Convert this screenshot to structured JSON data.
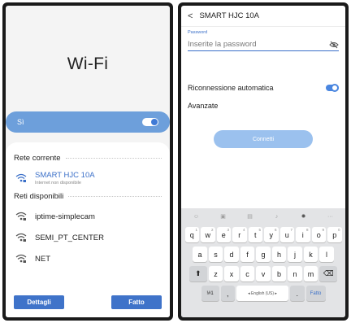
{
  "left_screen": {
    "title": "Wi-Fi",
    "toggle_label": "Sì",
    "current_section": "Rete corrente",
    "current_network": {
      "name": "SMART HJC 10A",
      "status": "Internet non disponibile"
    },
    "available_section": "Reti disponibili",
    "available_networks": [
      {
        "name": "iptime-simplecam"
      },
      {
        "name": "SEMI_PT_CENTER"
      },
      {
        "name": "NET"
      }
    ],
    "buttons": {
      "details": "Dettagli",
      "done": "Fatto"
    }
  },
  "right_screen": {
    "back_icon": "chevron-left-icon",
    "title": "SMART HJC 10A",
    "password_label": "Password",
    "password_placeholder": "Inserite la password",
    "password_value": "",
    "auto_reconnect_label": "Riconnessione automatica",
    "auto_reconnect_on": true,
    "advanced_label": "Avanzate",
    "connect_button": "Connetti",
    "keyboard": {
      "toolbar": [
        "emoji-icon",
        "sticker-icon",
        "gif-icon",
        "mic-icon",
        "gear-icon",
        "more-icon"
      ],
      "row1": [
        {
          "k": "q",
          "n": "1"
        },
        {
          "k": "w",
          "n": "2"
        },
        {
          "k": "e",
          "n": "3"
        },
        {
          "k": "r",
          "n": "4"
        },
        {
          "k": "t",
          "n": "5"
        },
        {
          "k": "y",
          "n": "6"
        },
        {
          "k": "u",
          "n": "7"
        },
        {
          "k": "i",
          "n": "8"
        },
        {
          "k": "o",
          "n": "9"
        },
        {
          "k": "p",
          "n": "0"
        }
      ],
      "row2": [
        "a",
        "s",
        "d",
        "f",
        "g",
        "h",
        "j",
        "k",
        "l"
      ],
      "row3": [
        "z",
        "x",
        "c",
        "v",
        "b",
        "n",
        "m"
      ],
      "symbols_key": "!#1",
      "comma_key": ",",
      "space_key": "◂ English (US) ▸",
      "period_key": ".",
      "done_key": "Fatto"
    }
  },
  "colors": {
    "accent": "#3f73c9",
    "toggle_bar": "#6d9fdb",
    "connect_disabled": "#9bc1ee"
  }
}
